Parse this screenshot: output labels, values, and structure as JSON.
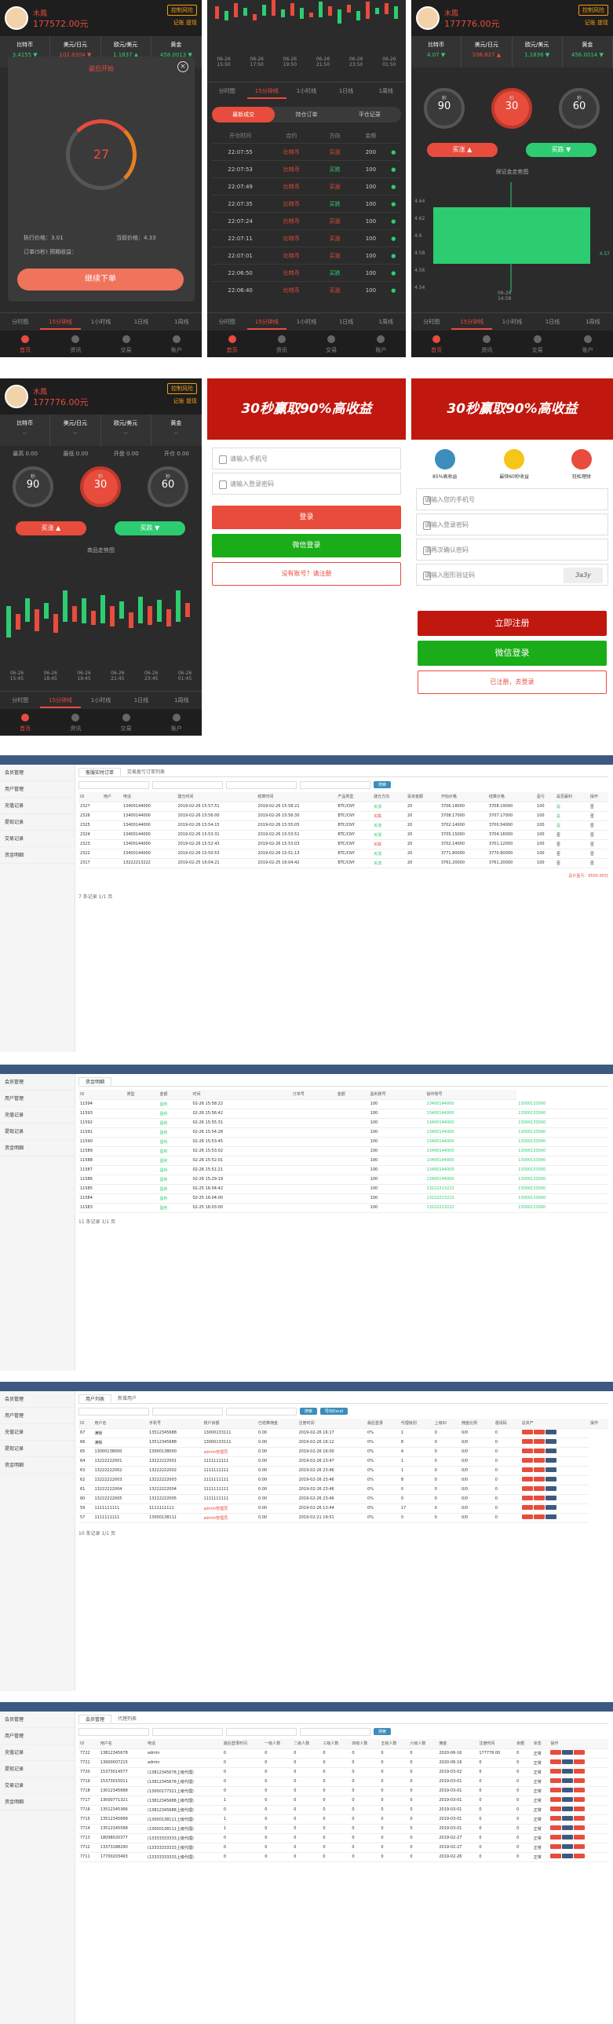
{
  "m1": {
    "user": "木鳳",
    "balance": "177572.00元",
    "ctrl_badge": "控制风险",
    "sub_links": "记账 提现",
    "quotes": [
      {
        "name": "比特币",
        "val": "3.4155 ▼"
      },
      {
        "name": "美元/日元",
        "val": "102.8304 ▼"
      },
      {
        "name": "欧元/美元",
        "val": "1.1837 ▲"
      },
      {
        "name": "黄金",
        "val": "458.0013 ▼"
      }
    ],
    "modal_title": "最后开始",
    "countdown": "27",
    "price_line": "执行价格：3.01",
    "cur_line": "当前价格：4.33",
    "order_line": "订单(5秒) 预期收益：",
    "cta": "继续下单",
    "tabs": [
      "分时图",
      "15分钟线",
      "1小时线",
      "1日线",
      "1周线"
    ],
    "nav": [
      "首页",
      "资讯",
      "交易",
      "账户"
    ]
  },
  "m2": {
    "xlabels": [
      "06-26\n15:50",
      "06-26\n17:50",
      "06-26\n19:50",
      "06-26\n21:50",
      "06-26\n23:50",
      "06-26\n01:50"
    ],
    "tabs": [
      "分时图",
      "15分钟线",
      "1小时线",
      "1日线",
      "1周线"
    ],
    "subtabs": [
      "最新成交",
      "持仓订单",
      "平仓记录"
    ],
    "cols": [
      "开仓时间",
      "合约",
      "方向",
      "金额",
      ""
    ],
    "rows": [
      [
        "22:07:55",
        "比特币",
        "买涨",
        "200"
      ],
      [
        "22:07:53",
        "比特币",
        "买跌",
        "100"
      ],
      [
        "22:07:49",
        "比特币",
        "买涨",
        "100"
      ],
      [
        "22:07:35",
        "比特币",
        "买跌",
        "100"
      ],
      [
        "22:07:24",
        "比特币",
        "买涨",
        "100"
      ],
      [
        "22:07:11",
        "比特币",
        "买涨",
        "100"
      ],
      [
        "22:07:01",
        "比特币",
        "买涨",
        "100"
      ],
      [
        "22:06:50",
        "比特币",
        "买跌",
        "100"
      ],
      [
        "22:06:40",
        "比特币",
        "买涨",
        "100"
      ]
    ],
    "nav": [
      "首页",
      "资讯",
      "交易",
      "账户"
    ]
  },
  "m3": {
    "user": "木鳳",
    "balance": "177776.00元",
    "ctrl_badge": "控制风险",
    "sub_links": "记账 提现",
    "quotes": [
      {
        "name": "比特币",
        "val": "4.07 ▼"
      },
      {
        "name": "美元/日元",
        "val": "106.827 ▲"
      },
      {
        "name": "欧元/美元",
        "val": "1.1836 ▼"
      },
      {
        "name": "黄金",
        "val": "456.0014 ▼"
      }
    ],
    "g1": "90",
    "g2": "30",
    "g3": "60",
    "g_unit": "秒",
    "buy": "买涨 ▲",
    "sell": "买跌 ▼",
    "chart_title": "保证金走势图",
    "yvals": [
      "4.64",
      "4.62",
      "4.6",
      "4.58",
      "4.56",
      "4.54"
    ],
    "last": "4.57",
    "xlabel": "06-26\n14:58",
    "tabs": [
      "分时图",
      "15分钟线",
      "1小时线",
      "1日线",
      "1周线"
    ],
    "nav": [
      "首页",
      "资讯",
      "交易",
      "账户"
    ]
  },
  "m4": {
    "user": "木鳳",
    "balance": "177776.00元",
    "ctrl_badge": "控制风险",
    "sub_links": "记账 提现",
    "quotes": [
      {
        "name": "比特币",
        "val": "--"
      },
      {
        "name": "美元/日元",
        "val": "--"
      },
      {
        "name": "欧元/美元",
        "val": "--"
      },
      {
        "name": "黄金",
        "val": "--"
      }
    ],
    "subrow": [
      {
        "k": "最高",
        "v": "0.00"
      },
      {
        "k": "最低",
        "v": "0.00"
      },
      {
        "k": "开盘",
        "v": "0.00"
      },
      {
        "k": "开仓",
        "v": "0.00"
      }
    ],
    "g1": "90",
    "g2": "30",
    "g3": "60",
    "g_unit": "秒",
    "buy": "买涨 ▲",
    "sell": "买跌 ▼",
    "chart_title": "商品走势图",
    "xlabels": [
      "06-26\n15:45",
      "06-26\n18:45",
      "06-26\n19:45",
      "06-26\n21:45",
      "06-26\n23:45",
      "06-26\n01:45"
    ],
    "tabs": [
      "分时图",
      "15分钟线",
      "1小时线",
      "1日线",
      "1周线"
    ],
    "nav": [
      "首页",
      "资讯",
      "交易",
      "账户"
    ]
  },
  "m5": {
    "banner": "30秒赢取90%高收益",
    "phone_ph": "请输入手机号",
    "pwd_ph": "请输入登录密码",
    "login": "登录",
    "wechat": "微信登录",
    "register": "没有账号？请注册"
  },
  "m6": {
    "banner": "30秒赢取90%高收益",
    "feat": [
      "85%高收益",
      "最快60秒收益",
      "轻松理财"
    ],
    "ph": [
      "请输入您的手机号",
      "请输入登录密码",
      "请再次确认密码",
      "请输入图形验证码"
    ],
    "captcha": "3a3y",
    "register": "立即注册",
    "wechat": "微信登录",
    "login_link": "已注册，去登录"
  },
  "a1": {
    "side": [
      "会员管理",
      "用户管理",
      "充值记录",
      "提现记录",
      "交易记录",
      "资金明细"
    ],
    "tabs": [
      "客服实时订单",
      "交易盈亏订单列表"
    ],
    "search": "搜索",
    "cols": [
      "ID",
      "用户",
      "电话",
      "建仓时间",
      "结算时间",
      "产品类型",
      "建仓方向",
      "投资金额",
      "开始价格",
      "结算价格",
      "盈亏",
      "是否赢利",
      "操作"
    ],
    "rows": [
      [
        "2327",
        "",
        "13400144000",
        "2019-02-26 15:57:51",
        "2019-02-26 15:58:21",
        "BTC/CNY",
        "买涨",
        "20",
        "3706.18000",
        "3708.19000",
        "100",
        "是",
        "否"
      ],
      [
        "2326",
        "",
        "13400144000",
        "2019-02-26 15:56:00",
        "2019-02-26 15:56:30",
        "BTC/CNY",
        "买跌",
        "20",
        "3708.17000",
        "3707.17000",
        "100",
        "是",
        "否"
      ],
      [
        "2325",
        "",
        "13400144000",
        "2019-02-26 15:54:15",
        "2019-02-26 15:55:05",
        "BTC/CNY",
        "买涨",
        "20",
        "3702.14000",
        "3700.54000",
        "100",
        "是",
        "否"
      ],
      [
        "2324",
        "",
        "13400144000",
        "2019-02-26 15:53:31",
        "2019-02-26 15:53:51",
        "BTC/CNY",
        "买涨",
        "20",
        "3705.15000",
        "3704.16000",
        "100",
        "否",
        "否"
      ],
      [
        "2323",
        "",
        "13400144000",
        "2019-02-26 15:52:43",
        "2019-02-26 15:53:03",
        "BTC/CNY",
        "买跌",
        "20",
        "3702.14000",
        "3701.12000",
        "100",
        "否",
        "否"
      ],
      [
        "2322",
        "",
        "13400144000",
        "2019-02-26 15:50:53",
        "2019-02-26 15:51:13",
        "BTC/CNY",
        "买涨",
        "20",
        "3771.80000",
        "3770.80000",
        "100",
        "否",
        "否"
      ],
      [
        "2317",
        "",
        "13222213222",
        "2019-02-25 16:04:21",
        "2019-02-25 16:04:42",
        "BTC/CNY",
        "买涨",
        "20",
        "3761.20000",
        "3761.20000",
        "100",
        "否",
        "否"
      ]
    ],
    "totals": "总计盈亏：6500.00元",
    "footer": "7 条记录 1/1 页"
  },
  "a2": {
    "side": [
      "会员管理",
      "用户管理",
      "充值记录",
      "提现记录",
      "资金明细"
    ],
    "tabs": [
      "资金明细"
    ],
    "cols": [
      "ID",
      "类型",
      "金额",
      "时间",
      "订单号",
      "金额",
      "盈利账号",
      "操作账号"
    ],
    "rows": [
      [
        "11594",
        "",
        "盈利",
        "02-26 15:58:22",
        "",
        "",
        "100",
        "13400144000",
        "13000133000"
      ],
      [
        "11593",
        "",
        "盈利",
        "02-26 15:56:42",
        "",
        "",
        "100",
        "13400144000",
        "13000133000"
      ],
      [
        "11592",
        "",
        "盈利",
        "02-26 15:55:31",
        "",
        "",
        "100",
        "13400144000",
        "13000133000"
      ],
      [
        "11591",
        "",
        "盈利",
        "02-26 15:54:28",
        "",
        "",
        "100",
        "13400144000",
        "13000133000"
      ],
      [
        "11590",
        "",
        "盈利",
        "02-26 15:53:45",
        "",
        "",
        "100",
        "13400144000",
        "13000133000"
      ],
      [
        "11589",
        "",
        "盈利",
        "02-26 15:53:02",
        "",
        "",
        "100",
        "13400144000",
        "13000133000"
      ],
      [
        "11588",
        "",
        "盈利",
        "02-26 15:52:01",
        "",
        "",
        "100",
        "13400144000",
        "13000133000"
      ],
      [
        "11587",
        "",
        "盈利",
        "02-26 15:51:21",
        "",
        "",
        "100",
        "13400144000",
        "13000133000"
      ],
      [
        "11586",
        "",
        "盈利",
        "02-26 15:29:19",
        "",
        "",
        "100",
        "13400144000",
        "13000133000"
      ],
      [
        "11585",
        "",
        "盈利",
        "02-25 16:04:42",
        "",
        "",
        "100",
        "13222213222",
        "13000133000"
      ],
      [
        "11584",
        "",
        "盈利",
        "02-25 16:04:00",
        "",
        "",
        "100",
        "13222213222",
        "13000133000"
      ],
      [
        "11583",
        "",
        "盈利",
        "02-25 16:03:00",
        "",
        "",
        "100",
        "13222213222",
        "13000133000"
      ]
    ],
    "footer": "11 条记录 1/1 页"
  },
  "a3": {
    "side": [
      "会员管理",
      "用户管理",
      "充值记录",
      "提现记录",
      "资金明细"
    ],
    "tabs": [
      "用户列表",
      "新增用户"
    ],
    "search": "搜索",
    "export": "导出Excel",
    "cols": [
      "ID",
      "用户名",
      "手机号",
      "账户余额",
      "已结算佣金",
      "注册时间",
      "最后登录",
      "代理级别",
      "上级ID",
      "佣金比例",
      "邀请码",
      "总资产",
      "操作"
    ],
    "rows": [
      [
        "67",
        "满街",
        "13512345688",
        "13000133111",
        "0.00",
        "2019-02-26 16:17",
        "0%",
        "1",
        "0",
        "0/0",
        "0"
      ],
      [
        "66",
        "满街",
        "13512345688",
        "13000133111",
        "0.00",
        "2019-02-26 16:12",
        "0%",
        "8",
        "0",
        "0/0",
        "0"
      ],
      [
        "65",
        "13000138000",
        "13000138000",
        "admin管理员",
        "0.00",
        "2019-02-26 16:00",
        "0%",
        "4",
        "0",
        "0/0",
        "0"
      ],
      [
        "64",
        "13222222001",
        "13222222001",
        "1111111111",
        "0.00",
        "2019-02-26 23:47",
        "0%",
        "1",
        "0",
        "0/0",
        "0"
      ],
      [
        "63",
        "13222222002",
        "13222222002",
        "1111111111",
        "0.00",
        "2019-02-26 23:46",
        "0%",
        "1",
        "0",
        "0/0",
        "0"
      ],
      [
        "62",
        "13222222003",
        "13222222003",
        "1111111111",
        "0.00",
        "2019-02-26 23:46",
        "0%",
        "8",
        "0",
        "0/0",
        "0"
      ],
      [
        "61",
        "13222222004",
        "13222222004",
        "1111111111",
        "0.00",
        "2019-02-26 23:46",
        "0%",
        "0",
        "0",
        "0/0",
        "0"
      ],
      [
        "60",
        "13222222005",
        "13222222005",
        "1111111111",
        "0.00",
        "2019-02-26 23:46",
        "0%",
        "0",
        "0",
        "0/0",
        "0"
      ],
      [
        "59",
        "1111111111",
        "1111111111",
        "admin管理员",
        "0.00",
        "2019-02-26 13:44",
        "0%",
        "17",
        "0",
        "0/0",
        "0"
      ],
      [
        "57",
        "1111111111",
        "13000138111",
        "admin管理员",
        "0.00",
        "2019-02-21 19:51",
        "0%",
        "0",
        "0",
        "0/0",
        "0"
      ]
    ],
    "footer": "10 条记录 1/1 页"
  },
  "a4": {
    "side": [
      "会员管理",
      "用户管理",
      "充值记录",
      "提现记录",
      "交易记录",
      "资金明细"
    ],
    "tabs": [
      "会员管理",
      "代理列表"
    ],
    "search": "搜索",
    "cols": [
      "ID",
      "用户名",
      "电话",
      "最后登录时间",
      "一级人数",
      "二级人数",
      "三级人数",
      "四级人数",
      "五级人数",
      "六级人数",
      "佣金",
      "注册时间",
      "余额",
      "状态",
      "操作"
    ],
    "rows": [
      [
        "7722",
        "13812345678",
        "admin",
        "0",
        "0",
        "0",
        "0",
        "0",
        "0",
        "0",
        "2020-06-16",
        "177776.00",
        "0",
        "正常"
      ],
      [
        "7721",
        "13900007215",
        "admin",
        "0",
        "0",
        "0",
        "0",
        "0",
        "0",
        "0",
        "2020-06-16",
        "0",
        "0",
        "正常"
      ],
      [
        "7720",
        "15373014577",
        "(13812345678上级代理)",
        "0",
        "0",
        "0",
        "0",
        "0",
        "0",
        "0",
        "2019-03-02",
        "0",
        "0",
        "正常"
      ],
      [
        "7719",
        "15373015011",
        "(13812345678上级代理)",
        "0",
        "0",
        "0",
        "0",
        "0",
        "0",
        "0",
        "2019-03-01",
        "0",
        "0",
        "正常"
      ],
      [
        "7718",
        "13012345688",
        "(13000177321上级代理)",
        "0",
        "0",
        "0",
        "0",
        "0",
        "0",
        "0",
        "2019-03-01",
        "0",
        "0",
        "正常"
      ],
      [
        "7717",
        "13000771321",
        "(13812345688上级代理)",
        "1",
        "0",
        "0",
        "0",
        "0",
        "0",
        "0",
        "2019-03-01",
        "0",
        "0",
        "正常"
      ],
      [
        "7716",
        "13512345366",
        "(13812345688上级代理)",
        "0",
        "0",
        "0",
        "0",
        "0",
        "0",
        "0",
        "2019-03-01",
        "0",
        "0",
        "正常"
      ],
      [
        "7715",
        "13512345688",
        "(13000138111上级代理)",
        "1",
        "0",
        "0",
        "0",
        "0",
        "0",
        "0",
        "2019-03-01",
        "0",
        "0",
        "正常"
      ],
      [
        "7714",
        "13512345588",
        "(13000138111上级代理)",
        "1",
        "0",
        "0",
        "0",
        "0",
        "0",
        "0",
        "2019-03-01",
        "0",
        "0",
        "正常"
      ],
      [
        "7713",
        "18098020377",
        "(13333333333上级代理)",
        "0",
        "0",
        "0",
        "0",
        "0",
        "0",
        "0",
        "2019-02-27",
        "0",
        "0",
        "正常"
      ],
      [
        "7712",
        "13373188290",
        "(13333333333上级代理)",
        "0",
        "0",
        "0",
        "0",
        "0",
        "0",
        "0",
        "2019-02-27",
        "0",
        "0",
        "正常"
      ],
      [
        "7711",
        "17700203493",
        "(13333333333上级代理)",
        "0",
        "0",
        "0",
        "0",
        "0",
        "0",
        "0",
        "2019-02-26",
        "0",
        "0",
        "正常"
      ]
    ]
  },
  "colors": {
    "red": "#e74c3c",
    "green": "#2ecc71",
    "dark": "#2b2b2b",
    "admin_top": "#3c5a80"
  }
}
